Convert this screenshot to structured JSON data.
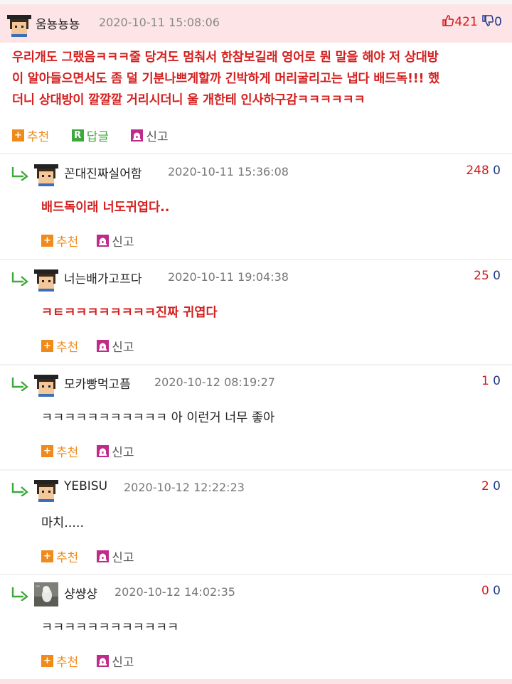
{
  "post": {
    "nickname": "움뇽뇽뇽",
    "timestamp": "2020-10-11 15:08:06",
    "upvotes": "421",
    "downvotes": "0",
    "body_lines": [
      "우리개도 그랬음ㅋㅋㅋ줄 당겨도 멈춰서 한참보길래 영어로 뭔 말을 해야 저 상대방",
      "이 알아들으면서도 좀 덜 기분나쁘게할까 긴박하게 머리굴리고는 냅다 배드독!!! 했",
      "더니 상대방이 깔깔깔 거리시더니 울 개한테 인사하구감ㅋㅋㅋㅋㅋㅋ"
    ],
    "actions": {
      "recommend": "추천",
      "reply_icon": "R",
      "reply": "답글",
      "report": "신고"
    }
  },
  "comment_actions": {
    "recommend": "추천",
    "report": "신고"
  },
  "comments": [
    {
      "nickname": "꼰대진짜실어함",
      "timestamp": "2020-10-11 15:36:08",
      "upvotes": "248",
      "downvotes": "0",
      "text": "배드독이래 너도귀엽다..",
      "style": "red",
      "avatar": "pixel"
    },
    {
      "nickname": "너는배가고프다",
      "timestamp": "2020-10-11 19:04:38",
      "upvotes": "25",
      "downvotes": "0",
      "text": "ㅋㅌㅋㅋㅋㅋㅋㅋㅋㅋ진짜 귀엽다",
      "style": "red",
      "avatar": "pixel"
    },
    {
      "nickname": "모카빵먹고픔",
      "timestamp": "2020-10-12 08:19:27",
      "upvotes": "1",
      "downvotes": "0",
      "text": "ㅋㅋㅋㅋㅋㅋㅋㅋㅋㅋㅋ 아 이런거 너무 좋아",
      "style": "plain",
      "avatar": "pixel"
    },
    {
      "nickname": "YEBISU",
      "timestamp": "2020-10-12 12:22:23",
      "upvotes": "2",
      "downvotes": "0",
      "text": "마치.....",
      "style": "plain",
      "avatar": "pixel"
    },
    {
      "nickname": "샹썅샹",
      "timestamp": "2020-10-12 14:02:35",
      "upvotes": "0",
      "downvotes": "0",
      "text": "ㅋㅋㅋㅋㅋㅋㅋㅋㅋㅋㅋㅋ",
      "style": "plain",
      "avatar": "photo"
    }
  ],
  "colors": {
    "header_bg": "#fde4e6",
    "accent_red": "#d42120",
    "upvote": "#d0191b",
    "downvote": "#1f3a8a",
    "recommend_orange": "#f08a1a",
    "reply_green": "#3ea83a"
  },
  "icons": {
    "avatar": "pixel-avatar-icon",
    "thumbs_up": "thumbs-up-icon",
    "thumbs_down": "thumbs-down-icon",
    "reply_arrow": "reply-arrow-icon",
    "recommend": "plus-icon",
    "report": "siren-icon"
  }
}
